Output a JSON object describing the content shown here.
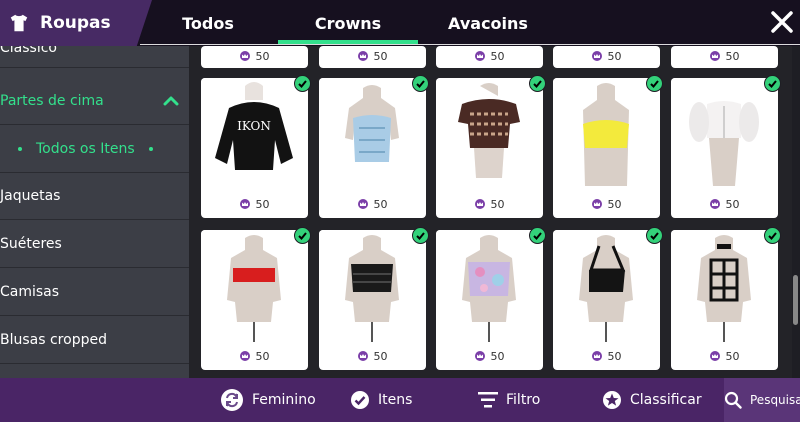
{
  "header": {
    "section_title": "Roupas",
    "tabs": [
      {
        "label": "Todos"
      },
      {
        "label": "Crowns"
      },
      {
        "label": "Avacoins"
      }
    ],
    "active_tab_index": 1
  },
  "sidebar": {
    "items": [
      {
        "label": "Clássico"
      },
      {
        "label": "Partes de cima",
        "expanded": true
      },
      {
        "label": "Todos os Itens",
        "selected": true
      },
      {
        "label": "Jaquetas"
      },
      {
        "label": "Suéteres"
      },
      {
        "label": "Camisas"
      },
      {
        "label": "Blusas cropped"
      }
    ]
  },
  "grid": {
    "partial_row_prices": [
      "50",
      "50",
      "50",
      "50",
      "50"
    ],
    "items": [
      {
        "price": "50",
        "owned": true,
        "garment": "black sweatshirt",
        "print": "IKON"
      },
      {
        "price": "50",
        "owned": true,
        "garment": "light blue corset"
      },
      {
        "price": "50",
        "owned": true,
        "garment": "patterned crop top"
      },
      {
        "price": "50",
        "owned": true,
        "garment": "yellow bandeau"
      },
      {
        "price": "50",
        "owned": true,
        "garment": "white puff-sleeve crop"
      },
      {
        "price": "50",
        "owned": true,
        "garment": "red tube top"
      },
      {
        "price": "50",
        "owned": true,
        "garment": "black strapless"
      },
      {
        "price": "50",
        "owned": true,
        "garment": "floral tube top"
      },
      {
        "price": "50",
        "owned": true,
        "garment": "black halter"
      },
      {
        "price": "50",
        "owned": true,
        "garment": "black strappy harness"
      }
    ]
  },
  "bottom_bar": {
    "items": [
      {
        "label": "Feminino",
        "icon": "gender-swap-icon"
      },
      {
        "label": "Itens",
        "icon": "check-circle-icon"
      },
      {
        "label": "Filtro",
        "icon": "filter-icon"
      },
      {
        "label": "Classificar",
        "icon": "sort-star-icon"
      },
      {
        "label": "Pesquisa",
        "icon": "search-icon"
      }
    ]
  },
  "colors": {
    "accent_green": "#33e08c",
    "header_purple": "#472a64",
    "bottom_purple": "#4a2566",
    "sidebar_bg": "#3c3e46",
    "crown_purple": "#7b3fa8"
  }
}
